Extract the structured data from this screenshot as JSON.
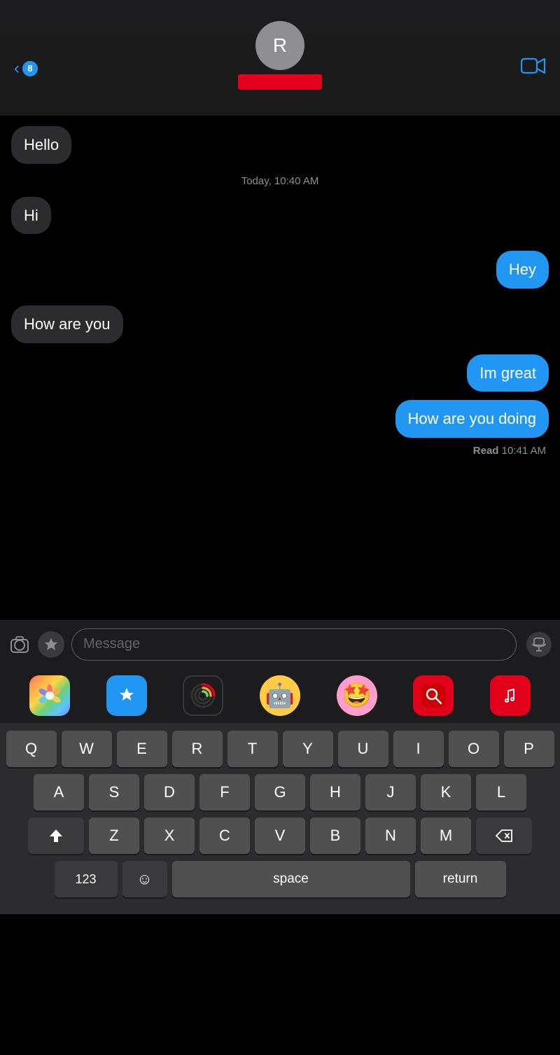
{
  "header": {
    "back_count": "8",
    "avatar_letter": "R",
    "video_icon": "📹"
  },
  "messages": [
    {
      "id": "msg1",
      "type": "received",
      "text": "Hello",
      "timestamp": null
    },
    {
      "id": "ts1",
      "type": "timestamp",
      "text": "Today, 10:40 AM"
    },
    {
      "id": "msg2",
      "type": "received",
      "text": "Hi",
      "timestamp": null
    },
    {
      "id": "msg3",
      "type": "sent",
      "text": "Hey",
      "timestamp": null
    },
    {
      "id": "msg4",
      "type": "received",
      "text": "How are you",
      "timestamp": null
    },
    {
      "id": "msg5",
      "type": "sent",
      "text": "Im great",
      "timestamp": null
    },
    {
      "id": "msg6",
      "type": "sent",
      "text": "How are you doing",
      "timestamp": null
    },
    {
      "id": "read1",
      "type": "read",
      "text": "Read 10:41 AM"
    }
  ],
  "input": {
    "placeholder": "Message"
  },
  "keyboard": {
    "row1": [
      "Q",
      "W",
      "E",
      "R",
      "T",
      "Y",
      "U",
      "I",
      "O",
      "P"
    ],
    "row2": [
      "A",
      "S",
      "D",
      "F",
      "G",
      "H",
      "J",
      "K",
      "L"
    ],
    "row3": [
      "Z",
      "X",
      "C",
      "V",
      "B",
      "N",
      "M"
    ],
    "space_label": "space",
    "return_label": "return",
    "num_label": "123"
  }
}
